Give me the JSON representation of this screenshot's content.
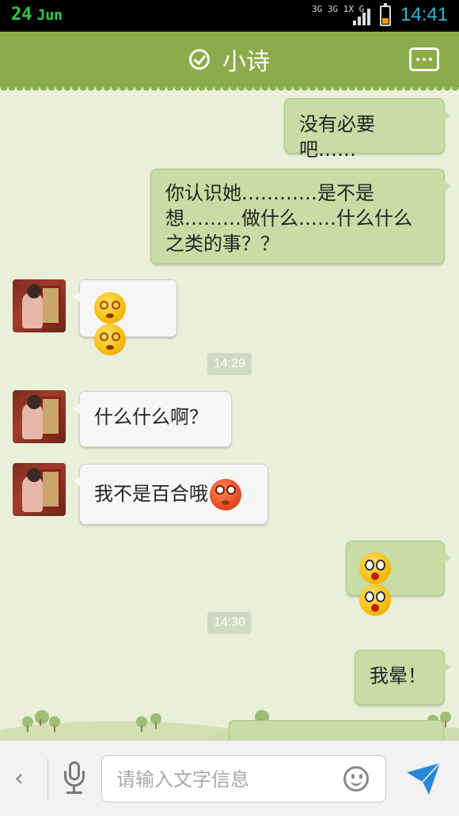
{
  "status_bar": {
    "date_day": "24",
    "date_month": "Jun",
    "network_top": "3G 3G 1X G",
    "time": "14:41",
    "battery_level": 0.25
  },
  "header": {
    "title": "小诗",
    "verified_icon": "check-circle-icon",
    "menu_icon": "more-dots-icon"
  },
  "messages": [
    {
      "direction": "outgoing",
      "text": "没有必要吧……"
    },
    {
      "direction": "outgoing",
      "text": "你认识她…………是不是想………做什么……什么什么之类的事？？"
    },
    {
      "direction": "incoming",
      "emojis": [
        "dizzy-face-emoji",
        "dizzy-face-emoji"
      ]
    },
    {
      "type": "timestamp",
      "text": "14:29"
    },
    {
      "direction": "incoming",
      "text": "什么什么啊？"
    },
    {
      "direction": "incoming",
      "text": "我不是百合哦",
      "emojis": [
        "eye-roll-emoji"
      ]
    },
    {
      "direction": "outgoing",
      "emojis": [
        "surprised-face-emoji",
        "surprised-face-emoji"
      ]
    },
    {
      "type": "timestamp",
      "text": "14:30"
    },
    {
      "direction": "outgoing",
      "text": "我晕！"
    }
  ],
  "input_bar": {
    "back_icon": "chevron-left-icon",
    "voice_icon": "microphone-icon",
    "placeholder": "请输入文字信息",
    "emoji_icon": "smiley-icon",
    "send_icon": "paper-plane-icon"
  },
  "colors": {
    "header": "#8cab4a",
    "background": "#e9efd9",
    "outgoing_bubble": "#c8dca5",
    "incoming_bubble": "#f6f6f6",
    "time_accent": "#2fb9d8",
    "send_accent": "#2a86d8"
  }
}
